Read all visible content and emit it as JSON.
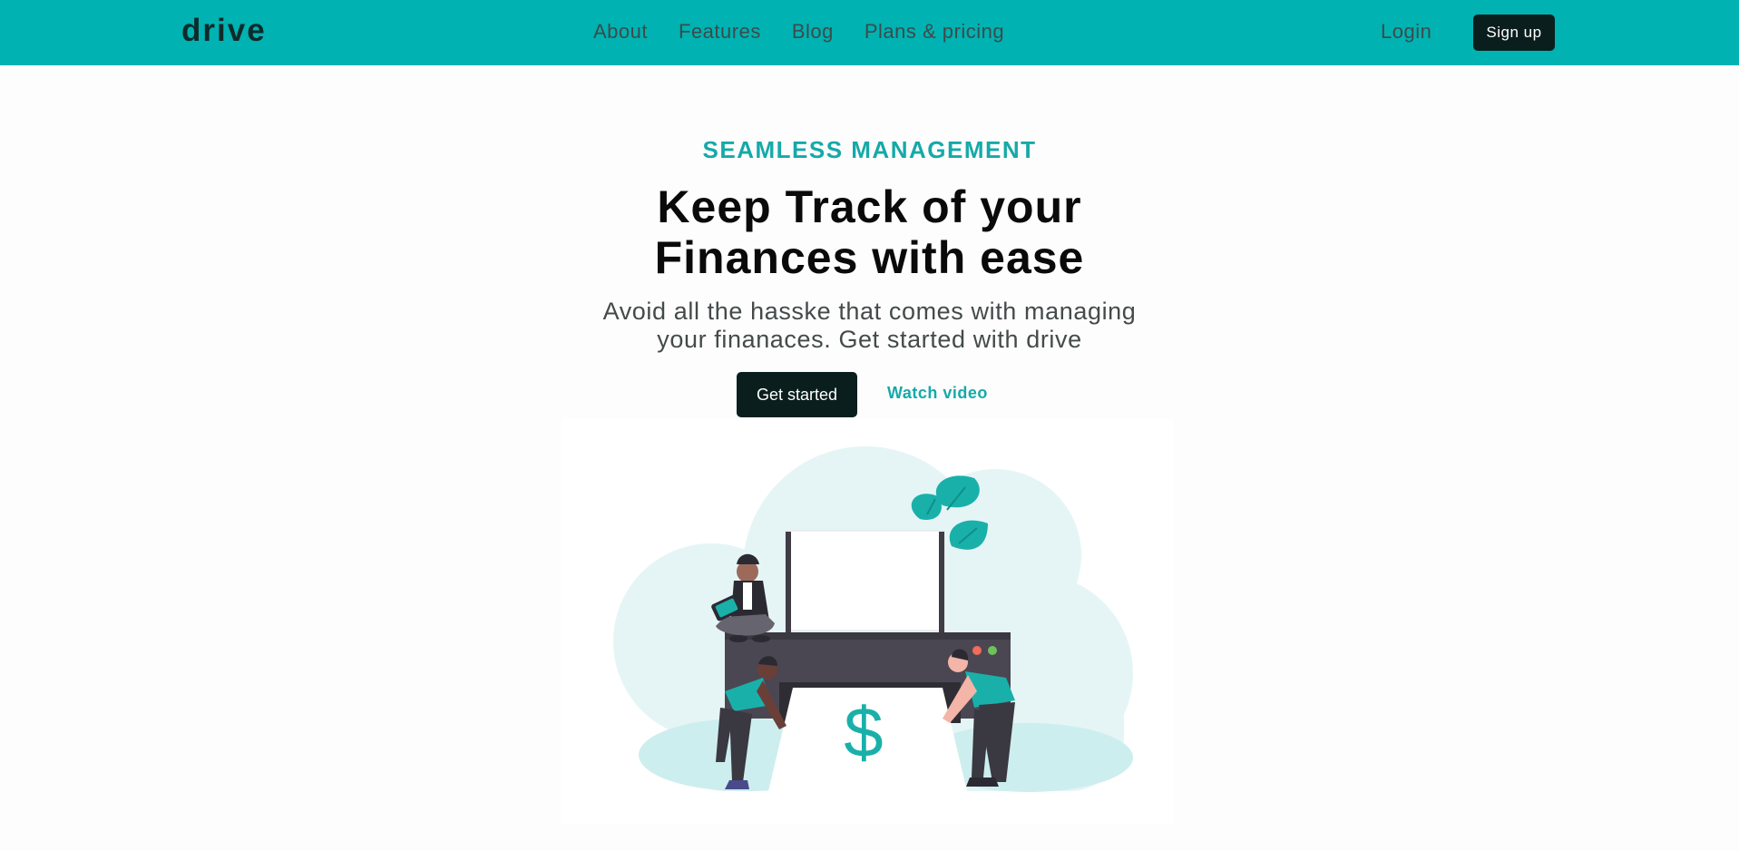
{
  "brand": {
    "logo_text": "drive"
  },
  "nav": {
    "links": [
      {
        "label": "About"
      },
      {
        "label": "Features"
      },
      {
        "label": "Blog"
      },
      {
        "label": "Plans & pricing"
      }
    ],
    "login_label": "Login",
    "signup_label": "Sign up"
  },
  "hero": {
    "eyebrow": "SEAMLESS MANAGEMENT",
    "headline_line1": "Keep Track of your",
    "headline_line2": "Finances with ease",
    "subtext_line1": "Avoid all the hasske that comes with managing",
    "subtext_line2": "your finanaces. Get started with drive",
    "cta_primary": "Get started",
    "cta_secondary": "Watch video",
    "illustration": {
      "symbol": "$",
      "icon": "finance-printer-illustration"
    }
  },
  "colors": {
    "navbar_bg": "#00b2b2",
    "accent": "#16a9a9",
    "dark_button": "#0b1e1e",
    "page_bg": "#fdfdfd",
    "illustration_blob": "#e5f5f5",
    "illustration_machine": "#4a4752"
  }
}
